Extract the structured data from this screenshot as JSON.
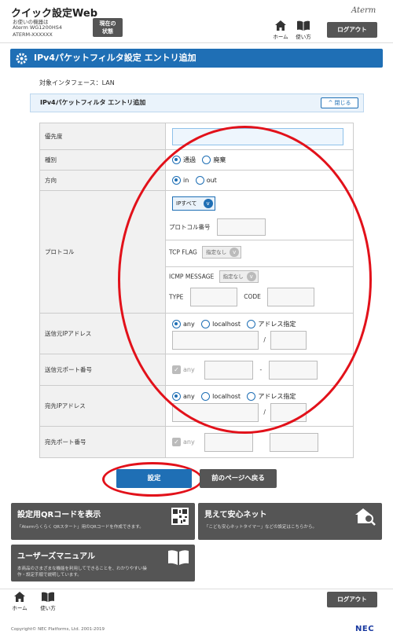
{
  "header": {
    "app_title": "クイック設定Web",
    "device_lines": [
      "お使いの機器は",
      "Aterm WG1200HS4",
      "ATERM-XXXXXX"
    ],
    "status_button": [
      "現在の",
      "状態"
    ],
    "home_label": "ホーム",
    "howto_label": "使い方",
    "brand": "Aterm",
    "logout_label": "ログアウト"
  },
  "page": {
    "title": "IPv4パケットフィルタ設定 エントリ追加",
    "interface_label": "対象インタフェース：LAN",
    "section_title": "IPv4パケットフィルタ エントリ追加",
    "collapse_label": "閉じる"
  },
  "form": {
    "priority": {
      "label": "優先度",
      "value": ""
    },
    "type": {
      "label": "種別",
      "options": [
        "通過",
        "廃棄"
      ],
      "selected": "通過"
    },
    "direction": {
      "label": "方向",
      "options": [
        "in",
        "out"
      ],
      "selected": "in"
    },
    "protocol": {
      "label": "プロトコル",
      "select_value": "IPすべて",
      "number_label": "プロトコル番号",
      "tcp_flag_label": "TCP FLAG",
      "tcp_flag_value": "指定なし",
      "icmp_label": "ICMP MESSAGE",
      "icmp_value": "指定なし",
      "type_label": "TYPE",
      "code_label": "CODE"
    },
    "src_ip": {
      "label": "送信元IPアドレス",
      "options": [
        "any",
        "localhost",
        "アドレス指定"
      ],
      "selected": "any",
      "separator": "/"
    },
    "src_port": {
      "label": "送信元ポート番号",
      "any_label": "any",
      "separator": "-"
    },
    "dst_ip": {
      "label": "宛先IPアドレス",
      "options": [
        "any",
        "localhost",
        "アドレス指定"
      ],
      "selected": "any",
      "separator": "/"
    },
    "dst_port": {
      "label": "宛先ポート番号",
      "any_label": "any"
    }
  },
  "actions": {
    "submit_label": "設定",
    "back_label": "前のページへ戻る"
  },
  "cards": [
    {
      "title": "設定用QRコードを表示",
      "desc": "「Atermらくらく QRスタート」用のQRコードを作成できます。",
      "icon": "qr-code-icon"
    },
    {
      "title": "見えて安心ネット",
      "desc": "「こども安心ネットタイマー」などの設定はこちらから。",
      "icon": "house-search-icon"
    },
    {
      "title": "ユーザーズマニュアル",
      "desc_lines": [
        "本商品のさまざまな機能を利用してできることを、わかりやすい操",
        "作・設定手順で説明しています。"
      ],
      "icon": "book-icon"
    }
  ],
  "footer": {
    "copyright": "Copyright© NEC Platforms, Ltd. 2001-2019",
    "logo": "NEC"
  },
  "colors": {
    "primary": "#1f6fb5",
    "dark_button": "#555555",
    "annotation": "#e2111a"
  }
}
